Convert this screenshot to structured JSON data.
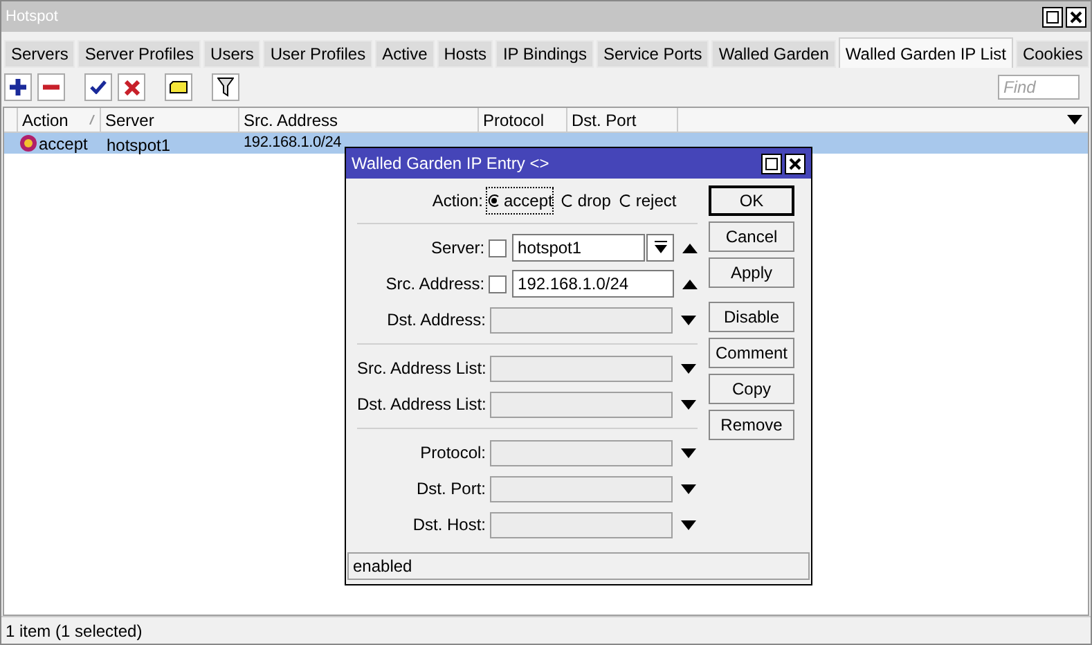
{
  "window": {
    "title": "Hotspot"
  },
  "tabs": [
    {
      "label": "Servers",
      "selected": false
    },
    {
      "label": "Server Profiles",
      "selected": false
    },
    {
      "label": "Users",
      "selected": false
    },
    {
      "label": "User Profiles",
      "selected": false
    },
    {
      "label": "Active",
      "selected": false
    },
    {
      "label": "Hosts",
      "selected": false
    },
    {
      "label": "IP Bindings",
      "selected": false
    },
    {
      "label": "Service Ports",
      "selected": false
    },
    {
      "label": "Walled Garden",
      "selected": false
    },
    {
      "label": "Walled Garden IP List",
      "selected": true
    },
    {
      "label": "Cookies",
      "selected": false
    }
  ],
  "toolbar": {
    "find_placeholder": "Find"
  },
  "table": {
    "columns": [
      {
        "label": "Action",
        "sorted": true
      },
      {
        "label": "Server",
        "sorted": false
      },
      {
        "label": "Src. Address",
        "sorted": false
      },
      {
        "label": "Protocol",
        "sorted": false
      },
      {
        "label": "Dst. Port",
        "sorted": false
      }
    ],
    "rows": [
      {
        "selected": true,
        "action": "accept",
        "server": "hotspot1",
        "src_address": "192.168.1.0/24"
      }
    ]
  },
  "status_bar": "1 item (1 selected)",
  "dialog": {
    "title": "Walled Garden IP Entry <>",
    "action": {
      "label": "Action:",
      "options": [
        {
          "label": "accept",
          "selected": true
        },
        {
          "label": "drop",
          "selected": false
        },
        {
          "label": "reject",
          "selected": false
        }
      ]
    },
    "groups": [
      [
        {
          "kind": "select",
          "label": "Server:",
          "value": "hotspot1",
          "negated": false
        },
        {
          "kind": "text",
          "label": "Src. Address:",
          "value": "192.168.1.0/24",
          "negated": false
        },
        {
          "kind": "empty",
          "label": "Dst. Address:"
        }
      ],
      [
        {
          "kind": "empty",
          "label": "Src. Address List:"
        },
        {
          "kind": "empty",
          "label": "Dst. Address List:"
        }
      ],
      [
        {
          "kind": "empty",
          "label": "Protocol:"
        },
        {
          "kind": "empty",
          "label": "Dst. Port:"
        },
        {
          "kind": "empty",
          "label": "Dst. Host:"
        }
      ]
    ],
    "buttons": [
      {
        "label": "OK",
        "default": true
      },
      {
        "label": "Cancel",
        "default": false
      },
      {
        "label": "Apply",
        "default": false
      },
      {
        "label": "Disable",
        "default": false
      },
      {
        "label": "Comment",
        "default": false
      },
      {
        "label": "Copy",
        "default": false
      },
      {
        "label": "Remove",
        "default": false
      }
    ],
    "status": "enabled"
  }
}
